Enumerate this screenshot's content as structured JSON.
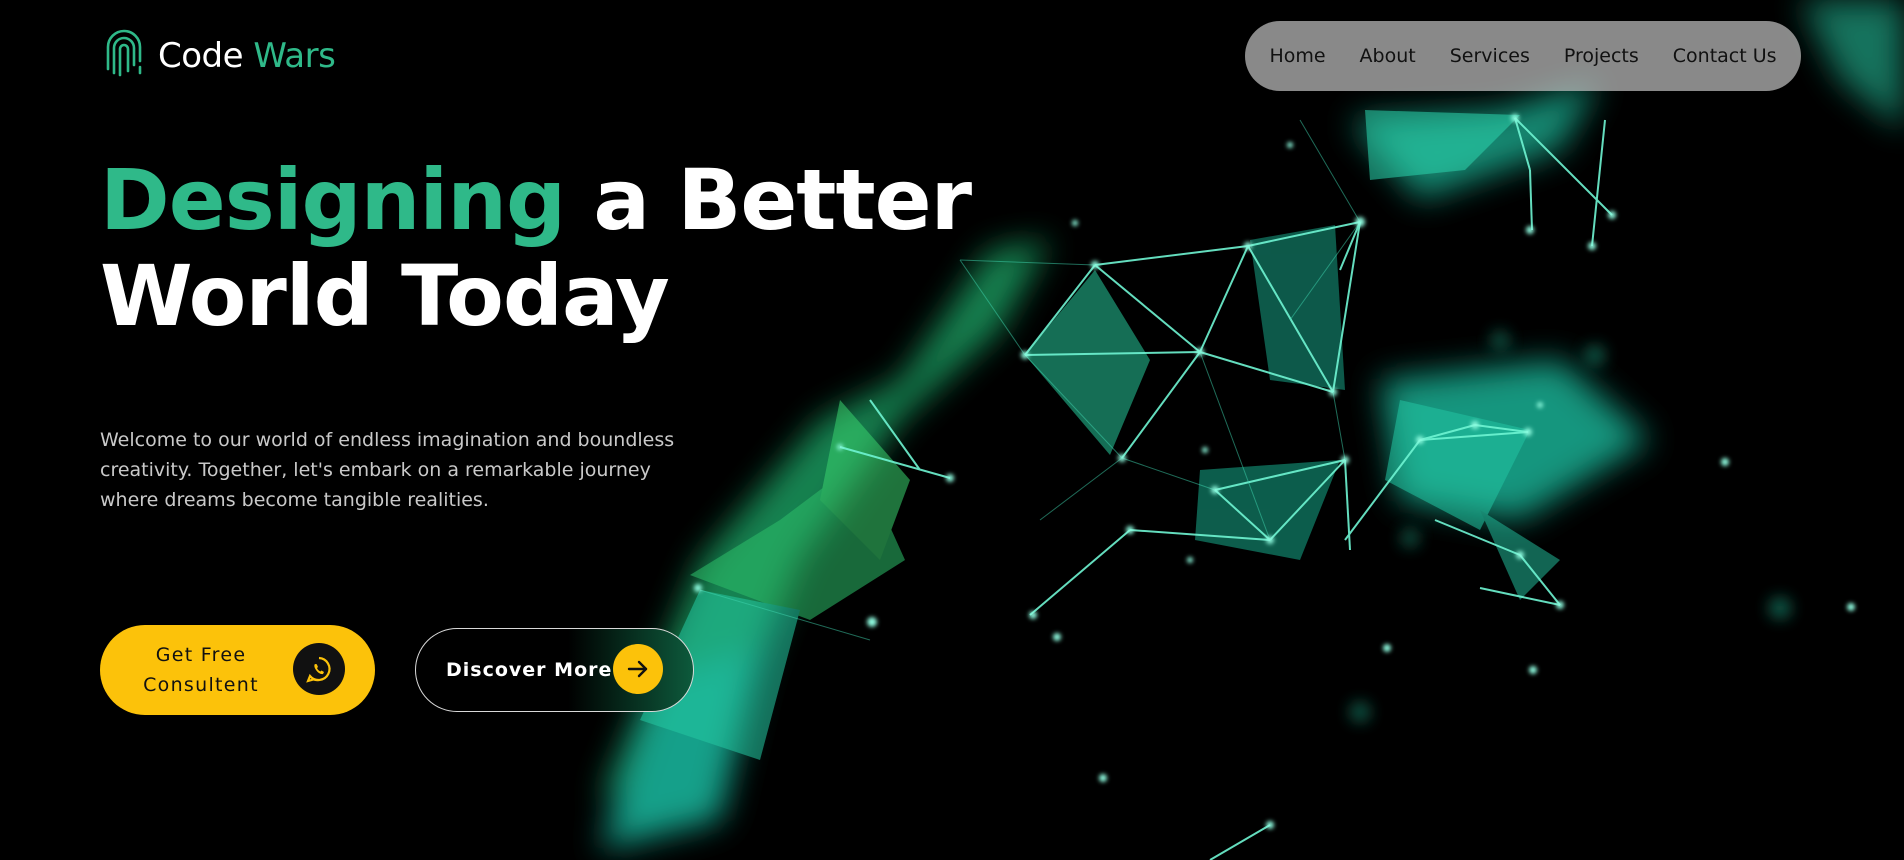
{
  "brand": {
    "name_part1": "Code",
    "name_part2": "Wars"
  },
  "nav": {
    "items": [
      "Home",
      "About",
      "Services",
      "Projects",
      "Contact Us"
    ]
  },
  "hero": {
    "headline_accent": "Designing",
    "headline_line1_rest": " a Better",
    "headline_line2": "World Today",
    "intro": "Welcome to our world of endless imagination and boundless creativity. Together, let's embark on a remarkable journey where dreams become tangible realities.",
    "primary_button_line1": "Get Free",
    "primary_button_line2": "Consultent",
    "secondary_button_label": "Discover More"
  },
  "colors": {
    "accent_green": "#2fb989",
    "button_yellow": "#fcc20a",
    "background": "#000000"
  },
  "icons": {
    "logo": "fingerprint-logo-icon",
    "primary_button": "whatsapp-icon",
    "secondary_button": "arrow-right-icon"
  }
}
